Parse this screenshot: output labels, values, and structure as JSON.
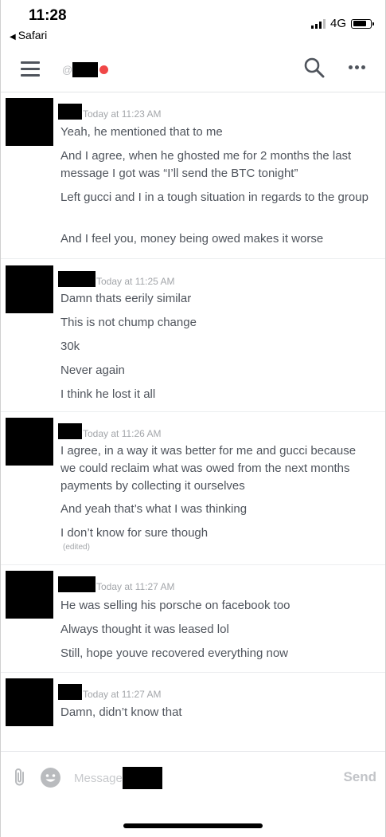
{
  "status_bar": {
    "time": "11:28",
    "back_app": "Safari",
    "network": "4G"
  },
  "top_nav": {
    "channel_prefix": "@"
  },
  "messages": [
    {
      "timestamp": "Today at 11:23 AM",
      "lines": [
        "Yeah, he mentioned that to me",
        "And I agree, when he ghosted me for 2 months the last message I got was “I’ll send the BTC tonight”",
        "Left gucci and I in a tough situation in regards to the group",
        "And I feel you, money being owed makes it worse"
      ]
    },
    {
      "timestamp": "Today at 11:25 AM",
      "lines": [
        "Damn thats eerily similar",
        "This is not chump change",
        "30k",
        "Never again",
        "I think he lost it all"
      ]
    },
    {
      "timestamp": "Today at 11:26 AM",
      "lines": [
        "I agree, in a way it was better for me and gucci because we could reclaim what was owed from the next months payments by collecting it ourselves",
        "And yeah that’s what I was thinking",
        "I don’t know for sure though"
      ],
      "edited": "(edited)"
    },
    {
      "timestamp": "Today at 11:27 AM",
      "lines": [
        "He was selling his porsche on facebook too",
        "Always thought it was leased lol",
        "Still, hope youve recovered everything now"
      ]
    },
    {
      "timestamp": "Today at 11:27 AM",
      "lines": [
        "Damn, didn’t know that"
      ]
    }
  ],
  "composer": {
    "placeholder": "Message",
    "send_label": "Send"
  },
  "colors": {
    "text": "#4f545c",
    "timestamp": "#a3a6aa",
    "status_dot": "#f04747",
    "send_disabled": "#c2c4c8"
  }
}
